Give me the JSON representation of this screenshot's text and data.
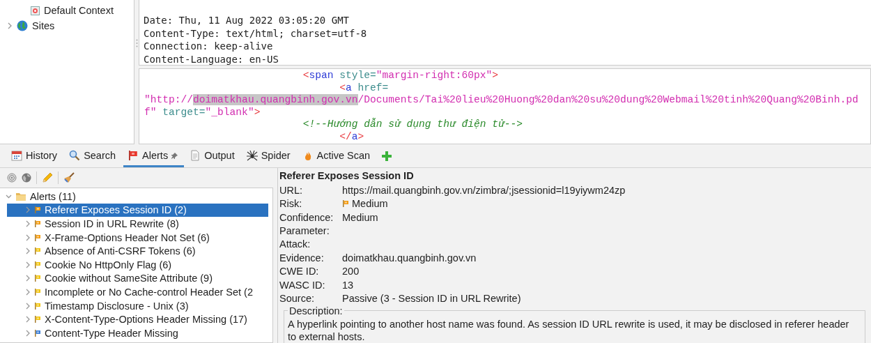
{
  "sites_tree": [
    {
      "label": "Default Context",
      "kind": "context"
    },
    {
      "label": "Sites",
      "kind": "sites",
      "expanded": false
    }
  ],
  "response_header": [
    "Date: Thu, 11 Aug 2022 03:05:20 GMT",
    "Content-Type: text/html; charset=utf-8",
    "Connection: keep-alive",
    "Content-Language: en-US"
  ],
  "response_body": [
    [
      {
        "text": "                          <",
        "kind": "punct"
      },
      {
        "text": "span",
        "kind": "name"
      },
      {
        "text": " style=",
        "kind": "attr"
      },
      {
        "text": "\"margin-right:60px\"",
        "kind": "value"
      },
      {
        "text": ">",
        "kind": "punct"
      }
    ],
    [
      {
        "text": "                                <",
        "kind": "punct"
      },
      {
        "text": "a",
        "kind": "name"
      },
      {
        "text": " href=",
        "kind": "attr"
      }
    ],
    [
      {
        "text": "\"http://",
        "kind": "value"
      },
      {
        "text": "doimatkhau.quangbinh.gov.vn",
        "kind": "value",
        "highlighted": true
      },
      {
        "text": "/Documents/Tai%20lieu%20Huong%20dan%20su%20dung%20Webmail%20tinh%20Quang%20Binh.pdf\"",
        "kind": "value"
      },
      {
        "text": " target=",
        "kind": "attr"
      },
      {
        "text": "\"_blank\"",
        "kind": "value"
      },
      {
        "text": ">",
        "kind": "punct"
      }
    ],
    [
      {
        "text": "                          <!--Hướng dẫn sử dụng thư điện tử-->",
        "kind": "comment"
      }
    ],
    [
      {
        "text": "                                </",
        "kind": "punct"
      },
      {
        "text": "a",
        "kind": "name"
      },
      {
        "text": ">",
        "kind": "punct"
      }
    ]
  ],
  "tabs": [
    {
      "label": "History",
      "selected": false
    },
    {
      "label": "Search",
      "selected": false
    },
    {
      "label": "Alerts",
      "selected": true,
      "pinned": true
    },
    {
      "label": "Output",
      "selected": false
    },
    {
      "label": "Spider",
      "selected": false
    },
    {
      "label": "Active Scan",
      "selected": false
    }
  ],
  "alerts_tree": {
    "label": "Alerts (11)",
    "expanded": true,
    "children": [
      {
        "label": "Referer Exposes Session ID (2)",
        "color": "#f39c12",
        "selected": true
      },
      {
        "label": "Session ID in URL Rewrite (8)",
        "color": "#f39c12",
        "selected": false
      },
      {
        "label": "X-Frame-Options Header Not Set (6)",
        "color": "#f39c12",
        "selected": false
      },
      {
        "label": "Absence of Anti-CSRF Tokens (6)",
        "color": "#f1c40f",
        "selected": false
      },
      {
        "label": "Cookie No HttpOnly Flag (6)",
        "color": "#f1c40f",
        "selected": false
      },
      {
        "label": "Cookie without SameSite Attribute (9)",
        "color": "#f1c40f",
        "selected": false
      },
      {
        "label": "Incomplete or No Cache-control Header Set (2",
        "color": "#f1c40f",
        "selected": false
      },
      {
        "label": "Timestamp Disclosure - Unix (3)",
        "color": "#f1c40f",
        "selected": false
      },
      {
        "label": "X-Content-Type-Options Header Missing (17)",
        "color": "#f1c40f",
        "selected": false
      },
      {
        "label": "Content-Type Header Missing",
        "color": "#3d7fd6",
        "selected": false
      }
    ]
  },
  "alert_detail": {
    "title": "Referer Exposes Session ID",
    "fields": [
      {
        "label": "URL:",
        "value": "https://mail.quangbinh.gov.vn/zimbra/;jsessionid=l19yiywm24zp"
      },
      {
        "label": "Risk:",
        "value": "Medium",
        "color": "#f39c12"
      },
      {
        "label": "Confidence:",
        "value": "Medium"
      },
      {
        "label": "Parameter:"
      },
      {
        "label": "Attack:"
      },
      {
        "label": "Evidence:",
        "value": "doimatkhau.quangbinh.gov.vn"
      },
      {
        "label": "CWE ID:",
        "value": "200"
      },
      {
        "label": "WASC ID:",
        "value": "13"
      },
      {
        "label": "Source:",
        "value": "Passive (3 - Session ID in URL Rewrite)"
      }
    ],
    "description_label": "Description:",
    "description": "A hyperlink pointing to another host name was found. As session ID URL rewrite is used, it may be disclosed in referer header to external hosts."
  }
}
